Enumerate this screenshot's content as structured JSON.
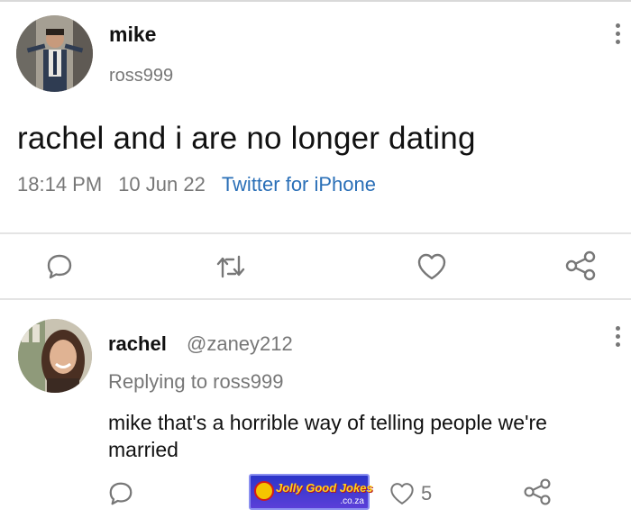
{
  "tweet": {
    "author_name": "mike",
    "author_handle": "ross999",
    "text": "rachel and i are no longer dating",
    "time": "18:14 PM",
    "date": "10 Jun 22",
    "source": "Twitter for iPhone"
  },
  "reply": {
    "author_name": "rachel",
    "author_handle": "@zaney212",
    "replying_to": "Replying to ross999",
    "text": "mike that's a horrible way of telling people we're married",
    "like_count": "5"
  },
  "watermark": {
    "brand": "Jolly Good Jokes",
    "domain": ".co.za"
  },
  "icons": {
    "reply": "reply-icon",
    "retweet": "retweet-icon",
    "like": "heart-icon",
    "share": "share-icon",
    "menu": "more-vertical-icon"
  },
  "colors": {
    "link": "#2a6fb7",
    "muted": "#777777",
    "text": "#111111"
  }
}
